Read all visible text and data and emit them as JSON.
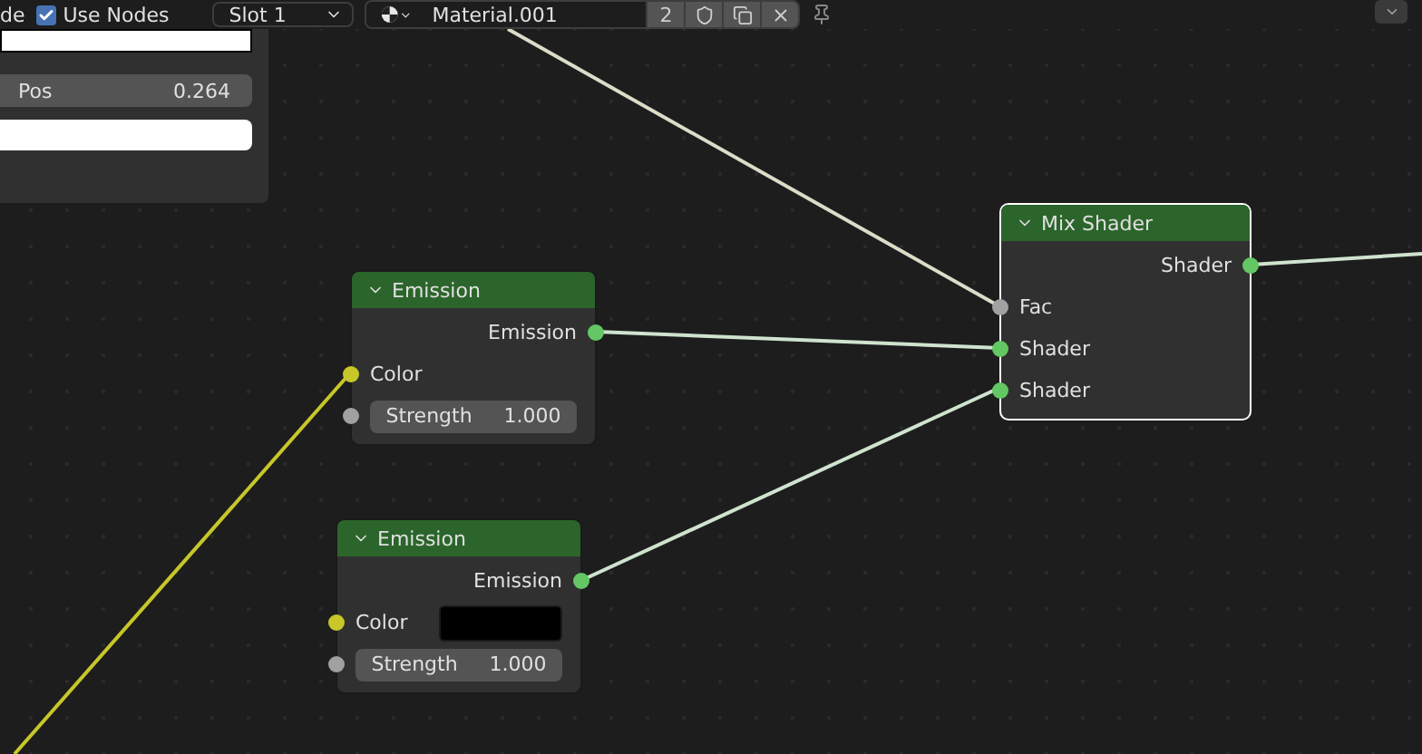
{
  "header": {
    "mode_label": "de",
    "use_nodes": {
      "label": "Use Nodes",
      "checked": true
    },
    "slot": "Slot 1",
    "material": {
      "name": "Material.001",
      "users": "2"
    }
  },
  "ramp_panel": {
    "pos": {
      "label": "Pos",
      "value": "0.264"
    }
  },
  "nodes": [
    {
      "title": "Emission",
      "selected": false,
      "sockets": [
        {
          "kind": "output",
          "label": "Emission",
          "color": "#63c763"
        },
        {
          "kind": "input",
          "label": "Color",
          "color": "#c7c729"
        },
        {
          "kind": "value",
          "label": "Strength",
          "value": "1.000",
          "color": "#a1a1a1"
        }
      ]
    },
    {
      "title": "Emission",
      "selected": false,
      "sockets": [
        {
          "kind": "output",
          "label": "Emission",
          "color": "#63c763"
        },
        {
          "kind": "swatch",
          "label": "Color",
          "color": "#c7c729",
          "field": {
            "color": "#000000"
          }
        },
        {
          "kind": "value",
          "label": "Strength",
          "value": "1.000",
          "color": "#a1a1a1"
        }
      ]
    },
    {
      "title": "Mix Shader",
      "selected": true,
      "sockets": [
        {
          "kind": "output",
          "label": "Shader",
          "color": "#63c763"
        },
        {
          "kind": "input",
          "label": "Fac",
          "color": "#a1a1a1"
        },
        {
          "kind": "input",
          "label": "Shader",
          "color": "#63c763"
        },
        {
          "kind": "input",
          "label": "Shader",
          "color": "#63c763"
        }
      ]
    }
  ]
}
